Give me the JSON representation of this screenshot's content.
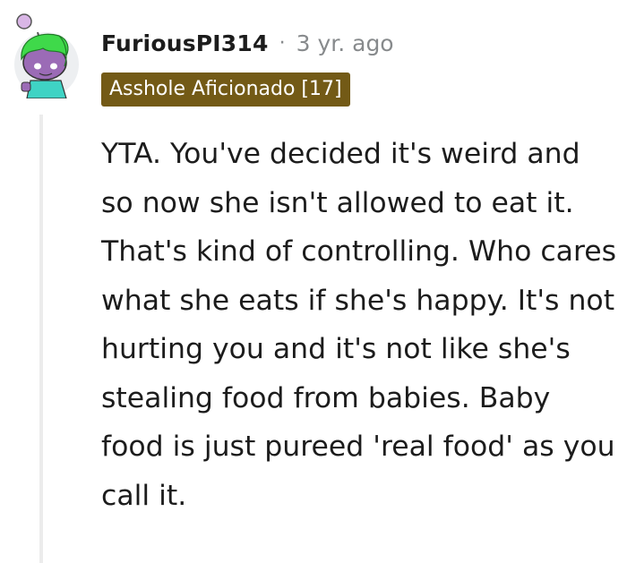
{
  "comment": {
    "username": "FuriousPI314",
    "separator": "·",
    "age": "3 yr. ago",
    "flair": {
      "text": "Asshole Aficionado [17]",
      "color": "#735a16"
    },
    "body": "YTA. You've decided it's weird and so now she isn't allowed to eat it. That's kind of controlling. Who cares what she eats if she's happy. It's not hurting you and it's not like she's stealing food from babies. Baby food is just pureed 'real food' as you call it.",
    "avatar": {
      "icon": "snoo-avatar-icon",
      "hair_color": "#3fd94a",
      "shirt_color": "#3fd3c4"
    }
  }
}
